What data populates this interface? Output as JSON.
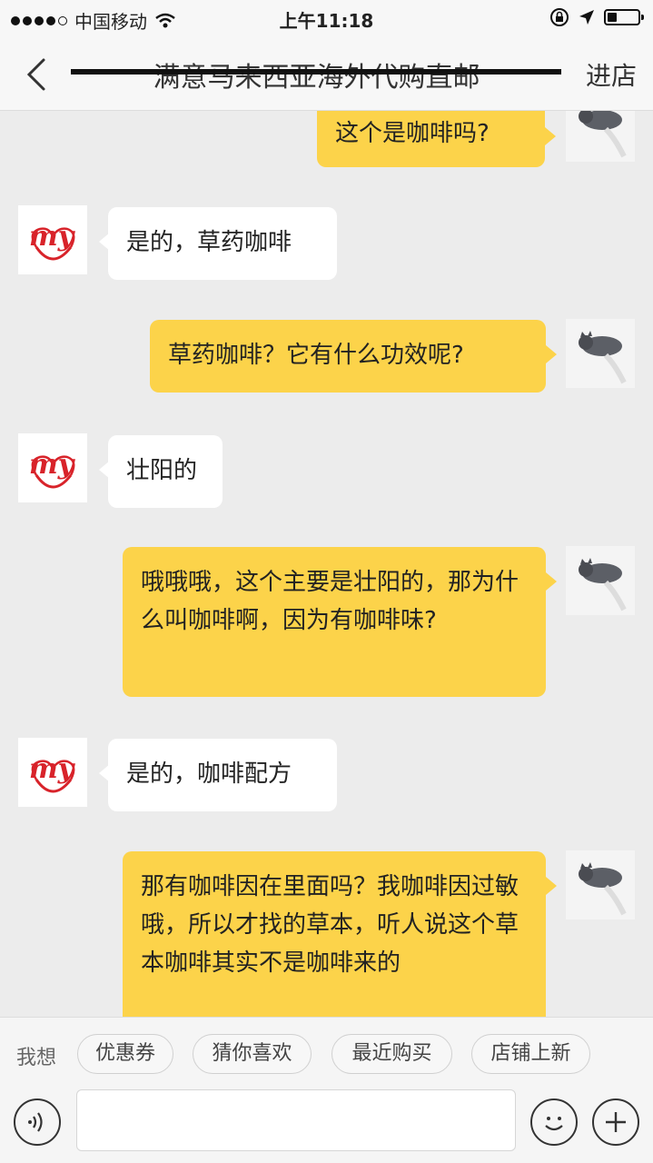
{
  "status_bar": {
    "carrier": "中国移动",
    "time": "上午11:18"
  },
  "nav": {
    "title": "满意马来西亚海外代购直邮",
    "enter_label": "进店"
  },
  "messages": [
    {
      "side": "out",
      "text": "这个是咖啡吗?"
    },
    {
      "side": "in",
      "text": "是的，草药咖啡"
    },
    {
      "side": "out",
      "text": "草药咖啡？它有什么功效呢?"
    },
    {
      "side": "in",
      "text": "壮阳的"
    },
    {
      "side": "out",
      "text": "哦哦哦，这个主要是壮阳的，那为什么叫咖啡啊，因为有咖啡味?"
    },
    {
      "side": "in",
      "text": "是的，咖啡配方"
    },
    {
      "side": "out",
      "text": "那有咖啡因在里面吗？我咖啡因过敏哦，所以才找的草本，听人说这个草本咖啡其实不是咖啡来的"
    }
  ],
  "quick_replies": {
    "label": "我想",
    "chips": [
      "优惠券",
      "猜你喜欢",
      "最近购买",
      "店铺上新"
    ]
  },
  "input": {
    "placeholder": ""
  },
  "colors": {
    "outgoing_bubble": "#fcd34a",
    "incoming_bubble": "#ffffff",
    "background": "#ececec",
    "logo_red": "#d8232a"
  },
  "icons": {
    "back": "chevron-left-icon",
    "voice": "voice-icon",
    "emoji": "emoji-icon",
    "add": "plus-icon"
  }
}
